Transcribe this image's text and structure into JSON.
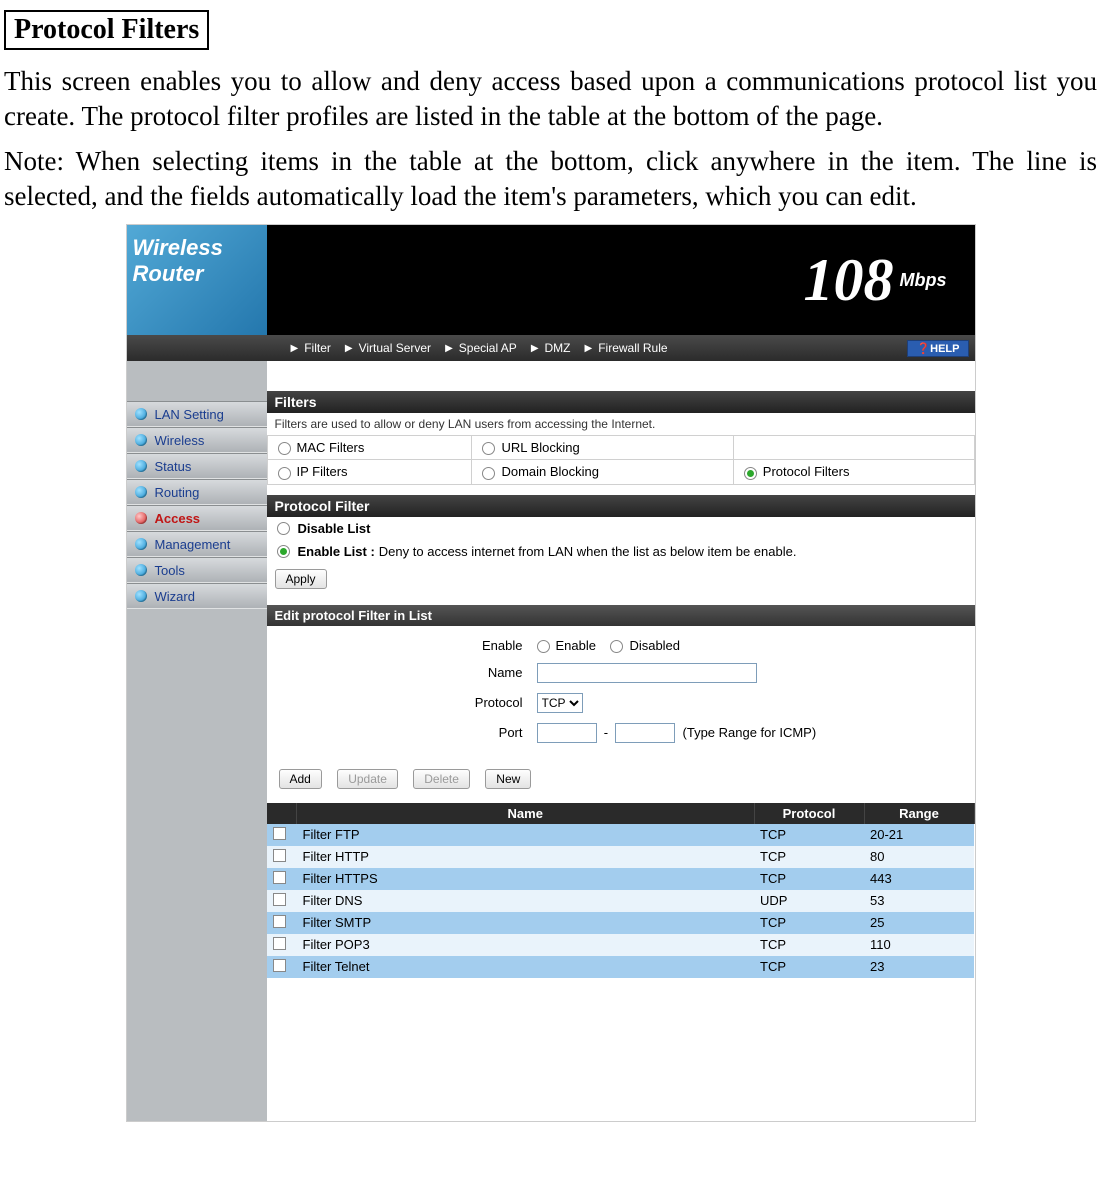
{
  "doc": {
    "title": "Protocol Filters",
    "p1": "This screen enables you to allow and deny access based upon a communications protocol list you create. The protocol filter profiles are listed in the table at the bottom of the page.",
    "p2": "Note: When selecting items in the table at the bottom, click anywhere in the item. The line is selected, and the fields automatically load the item's parameters, which you can edit."
  },
  "banner": {
    "t1": "Wireless",
    "t2": "Router",
    "big": "108",
    "unit": "Mbps"
  },
  "topnav": {
    "items": [
      "Filter",
      "Virtual Server",
      "Special AP",
      "DMZ",
      "Firewall Rule"
    ],
    "help": "HELP"
  },
  "sidebar": {
    "items": [
      "LAN Setting",
      "Wireless",
      "Status",
      "Routing",
      "Access",
      "Management",
      "Tools",
      "Wizard"
    ],
    "active_index": 4
  },
  "filters": {
    "title": "Filters",
    "subtitle": "Filters are used to allow or deny LAN users from accessing the Internet.",
    "opts": [
      "MAC Filters",
      "URL Blocking",
      "IP Filters",
      "Domain Blocking",
      "Protocol Filters"
    ],
    "selected_index": 4
  },
  "protocol_section": {
    "title": "Protocol Filter",
    "disable_label": "Disable List",
    "enable_label": "Enable List :",
    "enable_desc": "Deny to access internet from LAN when the list as below item be enable.",
    "apply": "Apply"
  },
  "edit_section": {
    "title": "Edit protocol Filter in List",
    "enable_label": "Enable",
    "enable_opt1": "Enable",
    "enable_opt2": "Disabled",
    "name_label": "Name",
    "name_value": "",
    "protocol_label": "Protocol",
    "protocol_value": "TCP",
    "port_label": "Port",
    "port_from": "",
    "port_to": "",
    "port_hint": "(Type Range for ICMP)"
  },
  "buttons": {
    "add": "Add",
    "update": "Update",
    "delete": "Delete",
    "new": "New"
  },
  "table": {
    "headers": [
      "",
      "Name",
      "Protocol",
      "Range"
    ],
    "rows": [
      {
        "name": "Filter FTP",
        "protocol": "TCP",
        "range": "20-21"
      },
      {
        "name": "Filter HTTP",
        "protocol": "TCP",
        "range": "80"
      },
      {
        "name": "Filter HTTPS",
        "protocol": "TCP",
        "range": "443"
      },
      {
        "name": "Filter DNS",
        "protocol": "UDP",
        "range": "53"
      },
      {
        "name": "Filter SMTP",
        "protocol": "TCP",
        "range": "25"
      },
      {
        "name": "Filter POP3",
        "protocol": "TCP",
        "range": "110"
      },
      {
        "name": "Filter Telnet",
        "protocol": "TCP",
        "range": "23"
      }
    ]
  }
}
